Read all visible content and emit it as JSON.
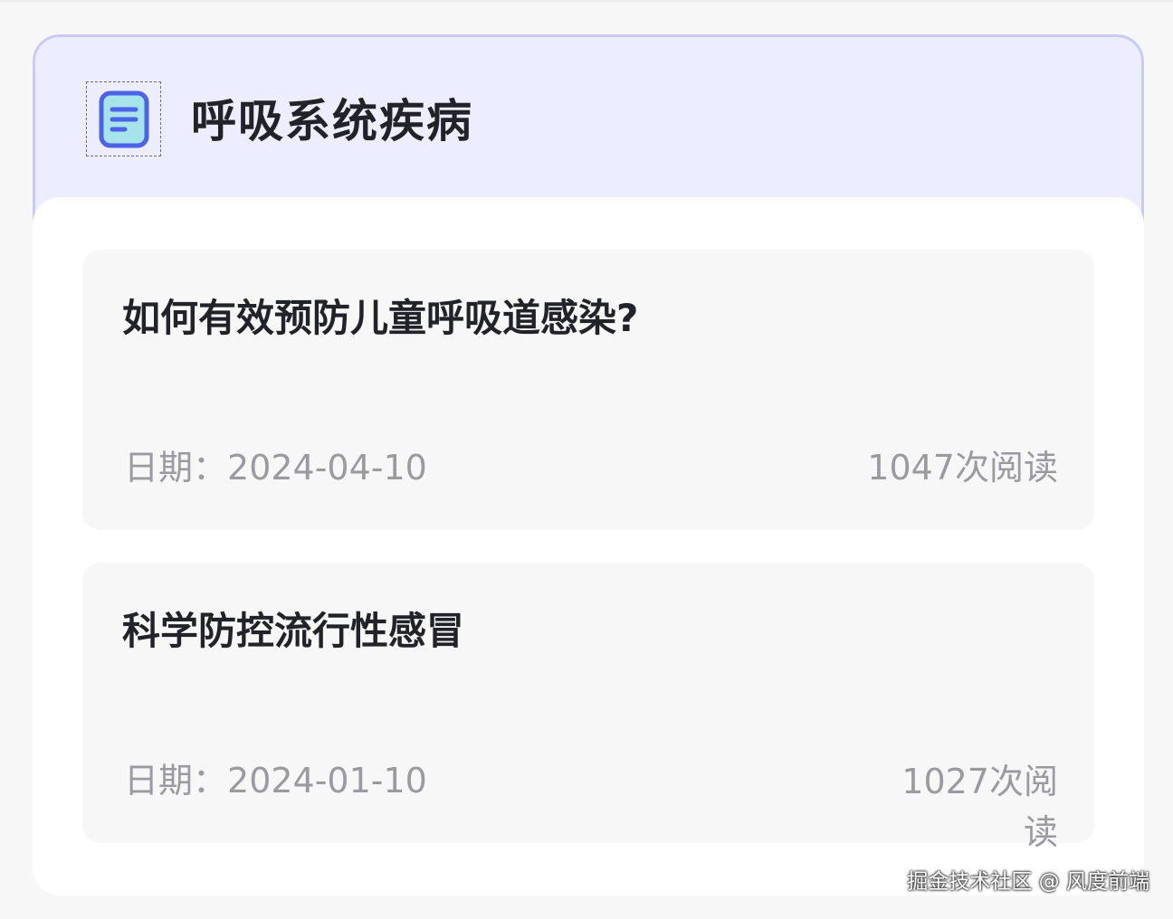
{
  "section": {
    "title": "呼吸系统疾病",
    "icon": "document-list-icon",
    "accent_color": "#4c63e8"
  },
  "articles": [
    {
      "title": "如何有效预防儿童呼吸道感染?",
      "date_label": "日期：",
      "date": "2024-04-10",
      "reads": "1047次阅读"
    },
    {
      "title": "科学防控流行性感冒",
      "date_label": "日期：",
      "date": "2024-01-10",
      "reads": "1027次阅读"
    }
  ],
  "watermark": "掘金技术社区 @ 风度前端"
}
